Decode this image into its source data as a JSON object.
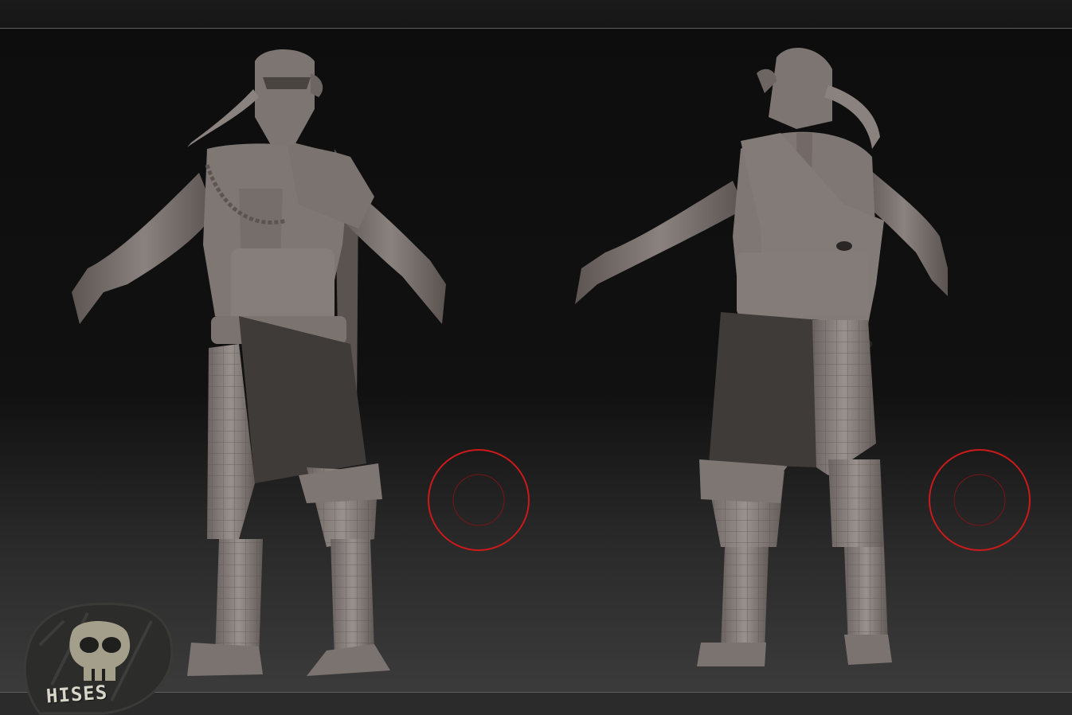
{
  "logo": {
    "text": "HISES"
  },
  "icons": {
    "logo": "skull-logo-icon",
    "gizmo": "rotation-gizmo-icon"
  },
  "colors": {
    "background": "#111111",
    "gizmo_ring": "#cc1a1a",
    "gizmo_inner": "#7a1515",
    "model_clay": "#7d7571",
    "model_dark": "#3f3b39",
    "logo_skull": "#a39f8a"
  }
}
